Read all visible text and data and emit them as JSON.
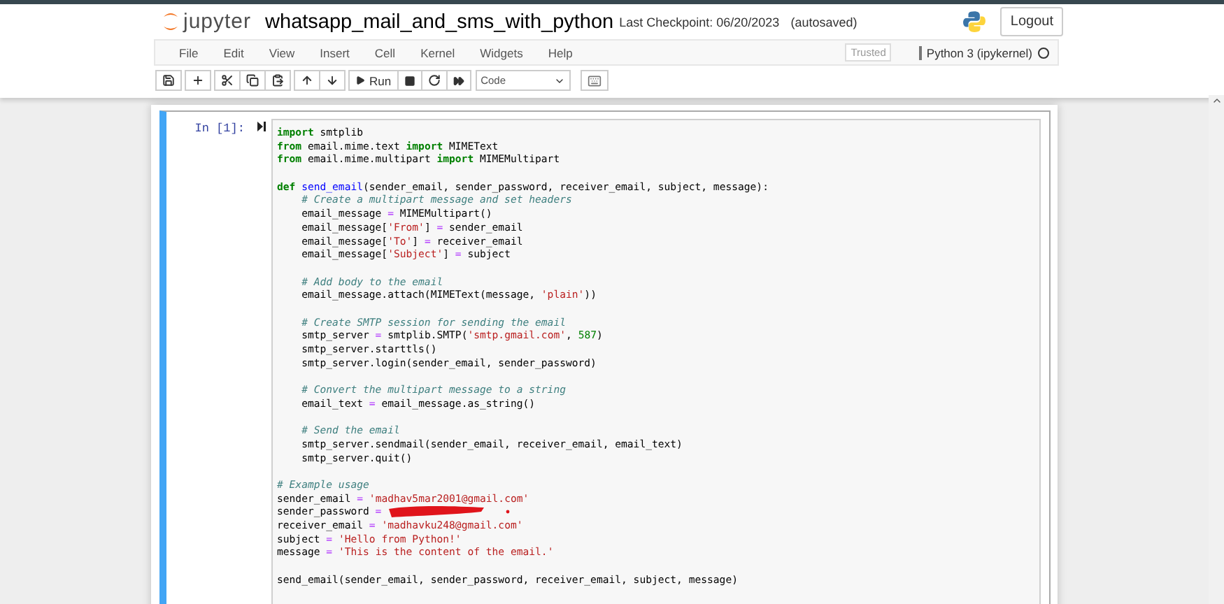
{
  "header": {
    "logo_text": "jupyter",
    "notebook_name": "whatsapp_mail_and_sms_with_python",
    "checkpoint": "Last Checkpoint: 06/20/2023",
    "autosave": "(autosaved)",
    "logout": "Logout"
  },
  "menu": [
    "File",
    "Edit",
    "View",
    "Insert",
    "Cell",
    "Kernel",
    "Widgets",
    "Help"
  ],
  "trusted": "Trusted",
  "kernel": {
    "name": "Python 3 (ipykernel)",
    "busy": false
  },
  "toolbar": {
    "run_label": "Run",
    "cell_type": "Code"
  },
  "cell": {
    "selected": true,
    "prompt": "In [1]:",
    "lines": [
      {
        "kind": "code",
        "tokens": [
          {
            "kind": "keyword",
            "text": "import"
          },
          {
            "kind": "plain",
            "text": " smtplib"
          }
        ]
      },
      {
        "kind": "code",
        "tokens": [
          {
            "kind": "keyword",
            "text": "from"
          },
          {
            "kind": "plain",
            "text": " email.mime.text "
          },
          {
            "kind": "keyword",
            "text": "import"
          },
          {
            "kind": "plain",
            "text": " MIMEText"
          }
        ]
      },
      {
        "kind": "code",
        "tokens": [
          {
            "kind": "keyword",
            "text": "from"
          },
          {
            "kind": "plain",
            "text": " email.mime.multipart "
          },
          {
            "kind": "keyword",
            "text": "import"
          },
          {
            "kind": "plain",
            "text": " MIMEMultipart"
          }
        ]
      },
      {
        "kind": "blank"
      },
      {
        "kind": "code",
        "tokens": [
          {
            "kind": "keyword",
            "text": "def "
          },
          {
            "kind": "function",
            "text": "send_email"
          },
          {
            "kind": "plain",
            "text": "(sender_email, sender_password, receiver_email, subject, message):"
          }
        ]
      },
      {
        "kind": "code",
        "tokens": [
          {
            "kind": "comment",
            "text": "    # Create a multipart message and set headers"
          }
        ]
      },
      {
        "kind": "code",
        "tokens": [
          {
            "kind": "plain",
            "text": "    email_message "
          },
          {
            "kind": "operator",
            "text": "="
          },
          {
            "kind": "plain",
            "text": " MIMEMultipart()"
          }
        ]
      },
      {
        "kind": "code",
        "tokens": [
          {
            "kind": "plain",
            "text": "    email_message["
          },
          {
            "kind": "string",
            "text": "'From'"
          },
          {
            "kind": "plain",
            "text": "] "
          },
          {
            "kind": "operator",
            "text": "="
          },
          {
            "kind": "plain",
            "text": " sender_email"
          }
        ]
      },
      {
        "kind": "code",
        "tokens": [
          {
            "kind": "plain",
            "text": "    email_message["
          },
          {
            "kind": "string",
            "text": "'To'"
          },
          {
            "kind": "plain",
            "text": "] "
          },
          {
            "kind": "operator",
            "text": "="
          },
          {
            "kind": "plain",
            "text": " receiver_email"
          }
        ]
      },
      {
        "kind": "code",
        "tokens": [
          {
            "kind": "plain",
            "text": "    email_message["
          },
          {
            "kind": "string",
            "text": "'Subject'"
          },
          {
            "kind": "plain",
            "text": "] "
          },
          {
            "kind": "operator",
            "text": "="
          },
          {
            "kind": "plain",
            "text": " subject"
          }
        ]
      },
      {
        "kind": "blank"
      },
      {
        "kind": "code",
        "tokens": [
          {
            "kind": "comment",
            "text": "    # Add body to the email"
          }
        ]
      },
      {
        "kind": "code",
        "tokens": [
          {
            "kind": "plain",
            "text": "    email_message.attach(MIMEText(message, "
          },
          {
            "kind": "string",
            "text": "'plain'"
          },
          {
            "kind": "plain",
            "text": "))"
          }
        ]
      },
      {
        "kind": "blank"
      },
      {
        "kind": "code",
        "tokens": [
          {
            "kind": "comment",
            "text": "    # Create SMTP session for sending the email"
          }
        ]
      },
      {
        "kind": "code",
        "tokens": [
          {
            "kind": "plain",
            "text": "    smtp_server "
          },
          {
            "kind": "operator",
            "text": "="
          },
          {
            "kind": "plain",
            "text": " smtplib.SMTP("
          },
          {
            "kind": "string",
            "text": "'smtp.gmail.com'"
          },
          {
            "kind": "plain",
            "text": ", "
          },
          {
            "kind": "number",
            "text": "587"
          },
          {
            "kind": "plain",
            "text": ")"
          }
        ]
      },
      {
        "kind": "code",
        "tokens": [
          {
            "kind": "plain",
            "text": "    smtp_server.starttls()"
          }
        ]
      },
      {
        "kind": "code",
        "tokens": [
          {
            "kind": "plain",
            "text": "    smtp_server.login(sender_email, sender_password)"
          }
        ]
      },
      {
        "kind": "blank"
      },
      {
        "kind": "code",
        "tokens": [
          {
            "kind": "comment",
            "text": "    # Convert the multipart message to a string"
          }
        ]
      },
      {
        "kind": "code",
        "tokens": [
          {
            "kind": "plain",
            "text": "    email_text "
          },
          {
            "kind": "operator",
            "text": "="
          },
          {
            "kind": "plain",
            "text": " email_message.as_string()"
          }
        ]
      },
      {
        "kind": "blank"
      },
      {
        "kind": "code",
        "tokens": [
          {
            "kind": "comment",
            "text": "    # Send the email"
          }
        ]
      },
      {
        "kind": "code",
        "tokens": [
          {
            "kind": "plain",
            "text": "    smtp_server.sendmail(sender_email, receiver_email, email_text)"
          }
        ]
      },
      {
        "kind": "code",
        "tokens": [
          {
            "kind": "plain",
            "text": "    smtp_server.quit()"
          }
        ]
      },
      {
        "kind": "blank"
      },
      {
        "kind": "code",
        "tokens": [
          {
            "kind": "comment",
            "text": "# Example usage"
          }
        ]
      },
      {
        "kind": "code",
        "tokens": [
          {
            "kind": "plain",
            "text": "sender_email "
          },
          {
            "kind": "operator",
            "text": "="
          },
          {
            "kind": "string",
            "text": " 'madhav5mar2001@gmail.com'"
          }
        ]
      },
      {
        "kind": "redacted",
        "tokens": [
          {
            "kind": "plain",
            "text": "sender_password "
          },
          {
            "kind": "operator",
            "text": "="
          }
        ]
      },
      {
        "kind": "code",
        "tokens": [
          {
            "kind": "plain",
            "text": "receiver_email "
          },
          {
            "kind": "operator",
            "text": "="
          },
          {
            "kind": "string",
            "text": " 'madhavku248@gmail.com'"
          }
        ]
      },
      {
        "kind": "code",
        "tokens": [
          {
            "kind": "plain",
            "text": "subject "
          },
          {
            "kind": "operator",
            "text": "="
          },
          {
            "kind": "string",
            "text": " 'Hello from Python!'"
          }
        ]
      },
      {
        "kind": "code",
        "tokens": [
          {
            "kind": "plain",
            "text": "message "
          },
          {
            "kind": "operator",
            "text": "="
          },
          {
            "kind": "string",
            "text": " 'This is the content of the email.'"
          }
        ]
      },
      {
        "kind": "blank"
      },
      {
        "kind": "code",
        "tokens": [
          {
            "kind": "plain",
            "text": "send_email(sender_email, sender_password, receiver_email, subject, message)"
          }
        ]
      }
    ]
  }
}
